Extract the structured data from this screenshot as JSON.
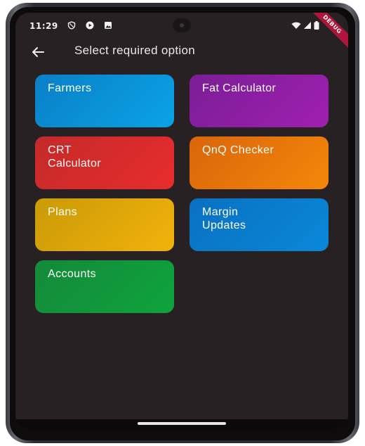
{
  "status_bar": {
    "time": "11:29",
    "debug_banner": "DEBUG",
    "icons": [
      "shield-icon",
      "play-icon",
      "photo-icon",
      "wifi-icon",
      "signal-icon",
      "battery-icon"
    ]
  },
  "app_bar": {
    "title": "Select required option",
    "back_icon": "arrow-left-icon"
  },
  "options": [
    {
      "label": "Farmers",
      "color_from": "#0a7fc6",
      "color_to": "#0aa3e6"
    },
    {
      "label": "Fat Calculator",
      "color_from": "#7a1e96",
      "color_to": "#a01fb0"
    },
    {
      "label": "CRT\nCalculator",
      "color_from": "#c42a2a",
      "color_to": "#e82c2c"
    },
    {
      "label": "QnQ Checker",
      "color_from": "#d9650a",
      "color_to": "#f5870a"
    },
    {
      "label": "Plans",
      "color_from": "#c99a08",
      "color_to": "#f2b20a"
    },
    {
      "label": "Margin\nUpdates",
      "color_from": "#0a70c0",
      "color_to": "#0a88d8"
    },
    {
      "label": "Accounts",
      "color_from": "#14893a",
      "color_to": "#0ea43c"
    }
  ]
}
